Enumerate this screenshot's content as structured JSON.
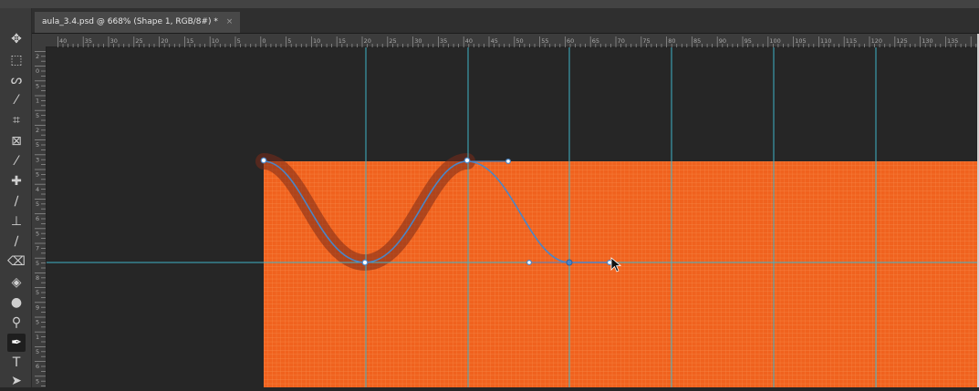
{
  "document_tab": {
    "title": "aula_3.4.psd @ 668% (Shape 1, RGB/8#) *",
    "close": "×"
  },
  "tools": [
    {
      "name": "move-tool-icon",
      "glyph": "✥"
    },
    {
      "name": "marquee-tool-icon",
      "glyph": "⬚"
    },
    {
      "name": "lasso-tool-icon",
      "glyph": "ᔕ"
    },
    {
      "name": "magic-wand-tool-icon",
      "glyph": "⁄"
    },
    {
      "name": "crop-tool-icon",
      "glyph": "⌗"
    },
    {
      "name": "frame-tool-icon",
      "glyph": "⊠"
    },
    {
      "name": "eyedropper-tool-icon",
      "glyph": "⁄"
    },
    {
      "name": "healing-brush-tool-icon",
      "glyph": "✚"
    },
    {
      "name": "brush-tool-icon",
      "glyph": "∕"
    },
    {
      "name": "clone-stamp-tool-icon",
      "glyph": "⊥"
    },
    {
      "name": "history-brush-tool-icon",
      "glyph": "∕"
    },
    {
      "name": "eraser-tool-icon",
      "glyph": "⌫"
    },
    {
      "name": "paint-bucket-tool-icon",
      "glyph": "◈"
    },
    {
      "name": "blur-tool-icon",
      "glyph": "●"
    },
    {
      "name": "dodge-tool-icon",
      "glyph": "⚲"
    },
    {
      "name": "pen-tool-icon",
      "glyph": "✒"
    },
    {
      "name": "type-tool-icon",
      "glyph": "T"
    },
    {
      "name": "path-selection-tool-icon",
      "glyph": "➤"
    }
  ],
  "ruler": {
    "h_labels": [
      "40",
      "35",
      "30",
      "25",
      "20",
      "15",
      "10",
      "5",
      "0",
      "5",
      "10",
      "15",
      "20",
      "25",
      "30",
      "35",
      "40",
      "45",
      "50",
      "55",
      "60",
      "65",
      "70",
      "75",
      "80",
      "85",
      "90",
      "95",
      "100",
      "105",
      "110",
      "115",
      "120",
      "125",
      "130",
      "135"
    ],
    "v_labels": [
      "2",
      "0",
      "5",
      "1",
      "5",
      "2",
      "5",
      "3",
      "5",
      "4",
      "5",
      "6",
      "5",
      "7",
      "5",
      "8",
      "5",
      "9",
      "5",
      "1",
      "5",
      "6",
      "5"
    ]
  },
  "colors": {
    "shape_fill": "#f0621e",
    "pixel_grid": "#f78a4a",
    "guide": "#3fb3c6",
    "path": "#4a86c8",
    "stroke_shadow": "#7a2a18",
    "pasteboard": "#262626"
  }
}
